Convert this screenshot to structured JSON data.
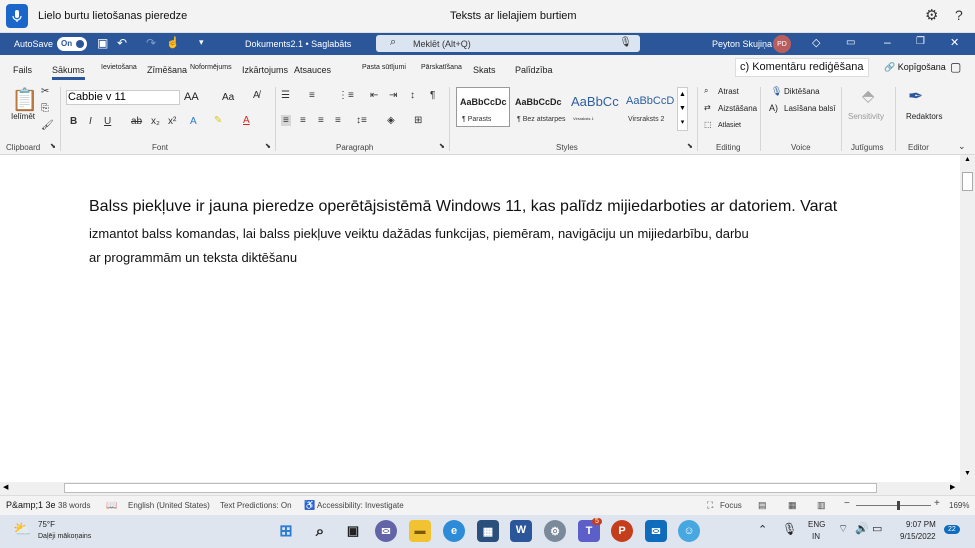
{
  "voice_bar": {
    "left_title": "Lielo burtu lietošanas pieredze",
    "center_title": "Teksts ar lielajiem burtiem",
    "gear_icon": "gear-icon",
    "help_label": "?"
  },
  "title_bar": {
    "autosave_label": "AutoSave",
    "autosave_state": "On",
    "doc_title": "Dokuments2.1 • Saglabāts",
    "search_placeholder": "Meklēt (Alt+Q)",
    "user_name": "Peyton Skujiņa",
    "user_initials": "PD"
  },
  "tabs": {
    "items": [
      "Fails",
      "Sākums",
      "Ievietošana",
      "Zīmēšana",
      "Noformējums",
      "Izkārtojums",
      "Atsauces",
      "Pasta sūtījumi",
      "Pārskatīšana",
      "Skats",
      "Palīdzība"
    ],
    "active": "Sākums",
    "comment_mode": "c) Komentāru rediģēšana",
    "copy_label": "Kopīgošana"
  },
  "ribbon": {
    "clipboard": {
      "paste_label": "Ielīmēt",
      "group_label": "Clipboard"
    },
    "font": {
      "name": "Cabbie v 11",
      "grow": "AA",
      "case": "Aa",
      "group_label": "Font"
    },
    "paragraph": {
      "group_label": "Paragraph",
      "pilcrow": "¶"
    },
    "styles": {
      "items": [
        {
          "preview": "AaBbCcDc",
          "name": "¶ Parasts"
        },
        {
          "preview": "AaBbCcDc",
          "name": "¶ Bez atstarpes"
        },
        {
          "preview": "AaBbCc",
          "name": "Virsraksts 1"
        },
        {
          "preview": "AaBbCcD",
          "name": "Virsraksts 2"
        }
      ],
      "group_label": "Styles"
    },
    "editing": {
      "find": "Atrast",
      "replace": "Aizstāšana",
      "select": "Atlasiet",
      "group_label": "Editing"
    },
    "voice": {
      "dictate": "Diktēšana",
      "read_aloud": "Lasīšana balsī",
      "group_label": "Voice"
    },
    "sensitivity": {
      "label": "Sensitivity",
      "group_label": "Jutīgums"
    },
    "editor": {
      "label": "Redaktors",
      "group_label": "Editor"
    }
  },
  "document": {
    "heading": "Balss piekļuve ir jauna pieredze operētājsistēmā Windows 11, kas palīdz mijiedarboties ar datoriem. Varat",
    "line2": "izmantot balss komandas, lai balss piekļuve veiktu dažādas funkcijas, piemēram, navigāciju un mijiedarbību, darbu",
    "line3": "ar programmām un teksta diktēšanu"
  },
  "status_bar": {
    "page": "P&amp;1 3e",
    "words": "38 words",
    "language": "English (United States)",
    "predictions": "Text Predictions: On",
    "accessibility": "Accessibility: Investigate",
    "focus": "Focus",
    "zoom": "169%"
  },
  "taskbar": {
    "weather_temp": "75°F",
    "weather_desc": "Daļēji mākoņains",
    "lang_top": "ENG",
    "lang_bottom": "IN",
    "time": "9:07 PM",
    "date": "9/15/2022",
    "notifications": "22",
    "teams_badge": "5"
  }
}
